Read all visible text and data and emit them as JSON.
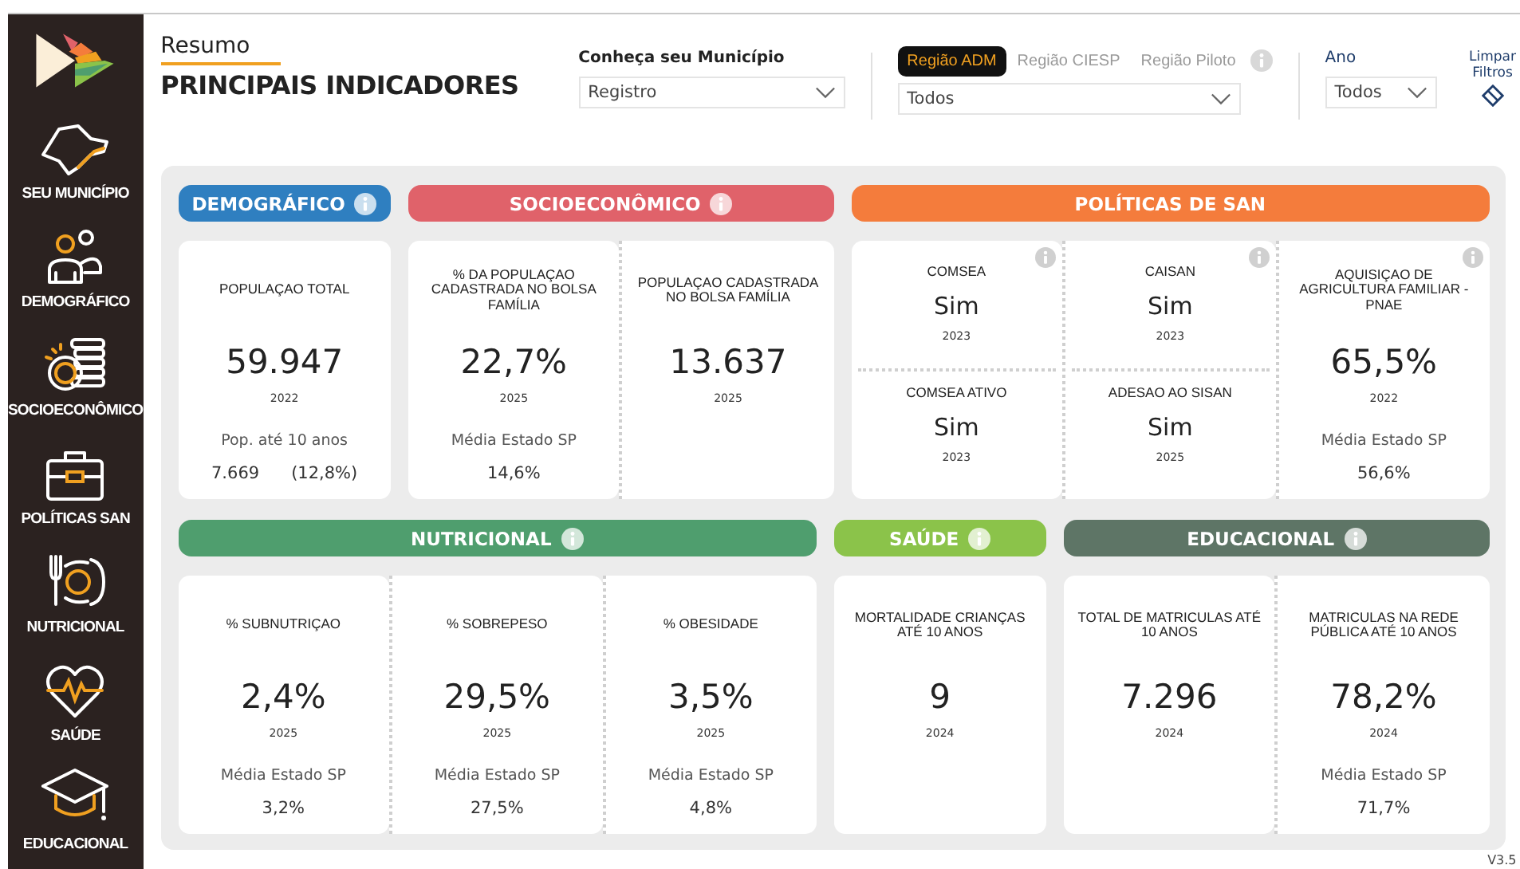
{
  "sidebar": {
    "items": [
      {
        "label": "SEU MUNICÍPIO"
      },
      {
        "label": "DEMOGRÁFICO"
      },
      {
        "label": "SOCIOECONÔMICO"
      },
      {
        "label": "POLÍTICAS SAN"
      },
      {
        "label": "NUTRICIONAL"
      },
      {
        "label": "SAÚDE"
      },
      {
        "label": "EDUCACIONAL"
      }
    ]
  },
  "header": {
    "subtitle": "Resumo",
    "title": "PRINCIPAIS INDICADORES"
  },
  "filters": {
    "municipio": {
      "label": "Conheça seu Município",
      "value": "Registro"
    },
    "region_tabs": [
      {
        "label": "Região ADM",
        "selected": true
      },
      {
        "label": "Região CIESP",
        "selected": false
      },
      {
        "label": "Região Piloto",
        "selected": false
      }
    ],
    "region": {
      "value": "Todos"
    },
    "ano": {
      "label": "Ano",
      "value": "Todos"
    },
    "clear": "Limpar Filtros"
  },
  "rows": [
    [
      {
        "title": "DEMOGRÁFICO",
        "color": "#2f7fc0",
        "info": true,
        "cards": [
          {
            "kind": "metric",
            "label": "POPULAÇAO TOTAL",
            "value": "59.947",
            "year": "2022",
            "foot_label": "Pop. até 10 anos",
            "foot_values": [
              "7.669",
              "(12,8%)"
            ],
            "info": false
          }
        ]
      },
      {
        "title": "SOCIOECONÔMICO",
        "color": "#e0626a",
        "info": true,
        "cards": [
          {
            "kind": "metric",
            "label": "% DA POPULAÇAO CADASTRADA NO BOLSA FAMÍLIA",
            "value": "22,7%",
            "year": "2025",
            "foot_label": "Média Estado SP",
            "foot_values": [
              "14,6%"
            ],
            "info": false
          },
          {
            "kind": "metric",
            "label": "POPULAÇAO CADASTRADA NO BOLSA FAMÍLIA",
            "value": "13.637",
            "year": "2025",
            "info": false
          }
        ]
      },
      {
        "title": "POLÍTICAS DE SAN",
        "color": "#f47c3c",
        "info": false,
        "cards": [
          {
            "kind": "split",
            "info": true,
            "items": [
              {
                "label": "COMSEA",
                "value": "Sim",
                "year": "2023"
              },
              {
                "label": "COMSEA ATIVO",
                "value": "Sim",
                "year": "2023"
              }
            ]
          },
          {
            "kind": "split",
            "info": true,
            "items": [
              {
                "label": "CAISAN",
                "value": "Sim",
                "year": "2023"
              },
              {
                "label": "ADESAO AO SISAN",
                "value": "Sim",
                "year": "2025"
              }
            ]
          },
          {
            "kind": "metric",
            "label": "AQUISIÇAO DE AGRICULTURA FAMILIAR - PNAE",
            "value": "65,5%",
            "year": "2022",
            "foot_label": "Média Estado SP",
            "foot_values": [
              "56,6%"
            ],
            "info": true
          }
        ]
      }
    ],
    [
      {
        "title": "NUTRICIONAL",
        "color": "#4f9e6e",
        "info": true,
        "cards": [
          {
            "kind": "metric",
            "label": "% SUBNUTRIÇAO",
            "value": "2,4%",
            "year": "2025",
            "foot_label": "Média Estado SP",
            "foot_values": [
              "3,2%"
            ],
            "info": false
          },
          {
            "kind": "metric",
            "label": "% SOBREPESO",
            "value": "29,5%",
            "year": "2025",
            "foot_label": "Média Estado SP",
            "foot_values": [
              "27,5%"
            ],
            "info": false
          },
          {
            "kind": "metric",
            "label": "% OBESIDADE",
            "value": "3,5%",
            "year": "2025",
            "foot_label": "Média Estado SP",
            "foot_values": [
              "4,8%"
            ],
            "info": false
          }
        ]
      },
      {
        "title": "SAÚDE",
        "color": "#8bc34a",
        "info": true,
        "cards": [
          {
            "kind": "metric",
            "label": "MORTALIDADE CRIANÇAS ATÉ 10 ANOS",
            "value": "9",
            "year": "2024",
            "info": false
          }
        ]
      },
      {
        "title": "EDUCACIONAL",
        "color": "#5e7566",
        "info": true,
        "cards": [
          {
            "kind": "metric",
            "label": "TOTAL DE MATRICULAS ATÉ 10 ANOS",
            "value": "7.296",
            "year": "2024",
            "info": false
          },
          {
            "kind": "metric",
            "label": "MATRICULAS NA REDE PÚBLICA ATÉ 10 ANOS",
            "value": "78,2%",
            "year": "2024",
            "foot_label": "Média Estado SP",
            "foot_values": [
              "71,7%"
            ],
            "info": false
          }
        ]
      }
    ]
  ],
  "version": "V3.5"
}
